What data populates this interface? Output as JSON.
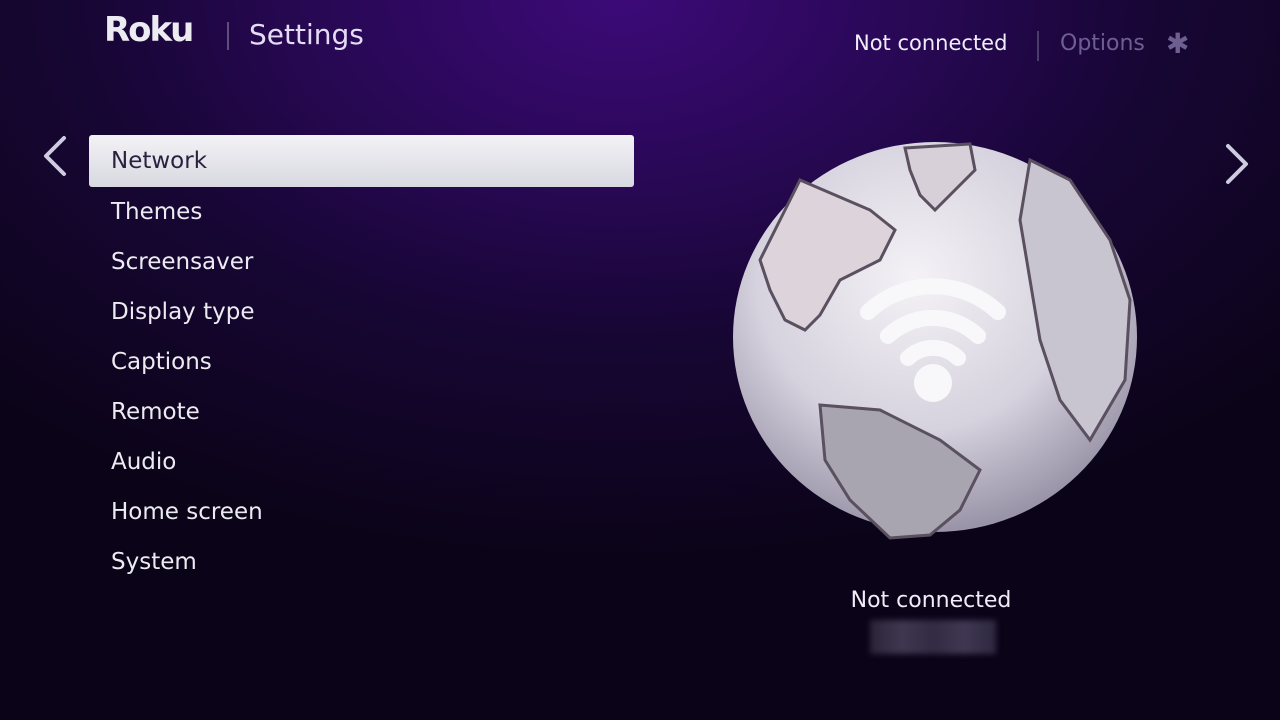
{
  "header": {
    "brand": "Roku",
    "title": "Settings",
    "status": "Not connected",
    "options_label": "Options",
    "options_icon": "asterisk-icon"
  },
  "navigation": {
    "left_icon": "chevron-left-icon",
    "right_icon": "chevron-right-icon"
  },
  "menu": {
    "selected_index": 0,
    "items": [
      {
        "label": "Network"
      },
      {
        "label": "Themes"
      },
      {
        "label": "Screensaver"
      },
      {
        "label": "Display type"
      },
      {
        "label": "Captions"
      },
      {
        "label": "Remote"
      },
      {
        "label": "Audio"
      },
      {
        "label": "Home screen"
      },
      {
        "label": "System"
      }
    ]
  },
  "detail": {
    "illustration": "globe-wifi-icon",
    "status": "Not connected",
    "network_name": "(blurred)"
  },
  "colors": {
    "background": "#2a0858",
    "selected_bg": "#e8e8ee",
    "text": "#ecebf2"
  }
}
